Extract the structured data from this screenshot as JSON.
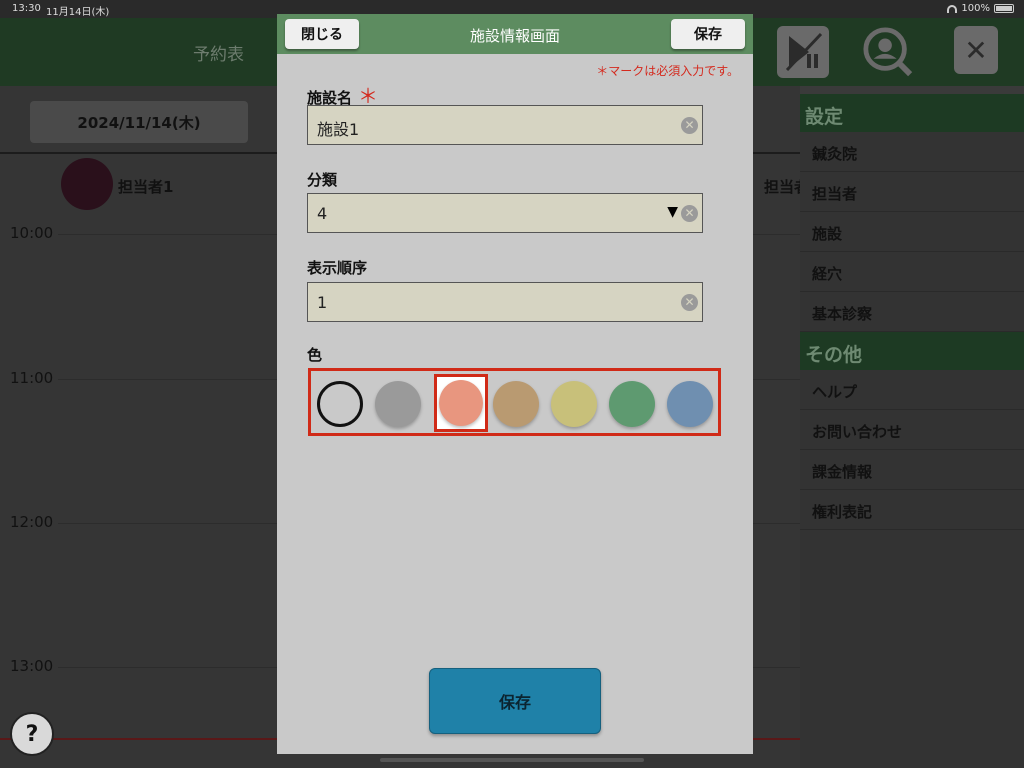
{
  "statusbar": {
    "time": "13:30",
    "date": "11月14日(木)",
    "battery": "100%"
  },
  "background": {
    "title": "予約表",
    "date_button": "2024/11/14(木)",
    "staff": [
      "担当者1",
      "担当者"
    ],
    "hours": [
      "10:00",
      "11:00",
      "12:00",
      "13:00"
    ],
    "help_label": "?",
    "close_label": "✕"
  },
  "sidebar": {
    "sections": [
      {
        "title": "設定",
        "items": [
          "鍼灸院",
          "担当者",
          "施設",
          "経穴",
          "基本診察"
        ]
      },
      {
        "title": "その他",
        "items": [
          "ヘルプ",
          "お問い合わせ",
          "課金情報",
          "権利表記"
        ]
      }
    ]
  },
  "modal": {
    "title": "施設情報画面",
    "close_button": "閉じる",
    "save_button": "保存",
    "required_note": "＊マークは必須入力です。",
    "required_mark": "＊",
    "fields": {
      "name": {
        "label": "施設名",
        "value": "施設1"
      },
      "category": {
        "label": "分類",
        "value": "4"
      },
      "order": {
        "label": "表示順序",
        "value": "1"
      }
    },
    "color_label": "色",
    "colors": [
      "none",
      "#9a9a9a",
      "#e8967f",
      "#b99a71",
      "#c8c07a",
      "#5e9a70",
      "#6f8fb0"
    ],
    "selected_color_index": 2,
    "bottom_save": "保存"
  }
}
